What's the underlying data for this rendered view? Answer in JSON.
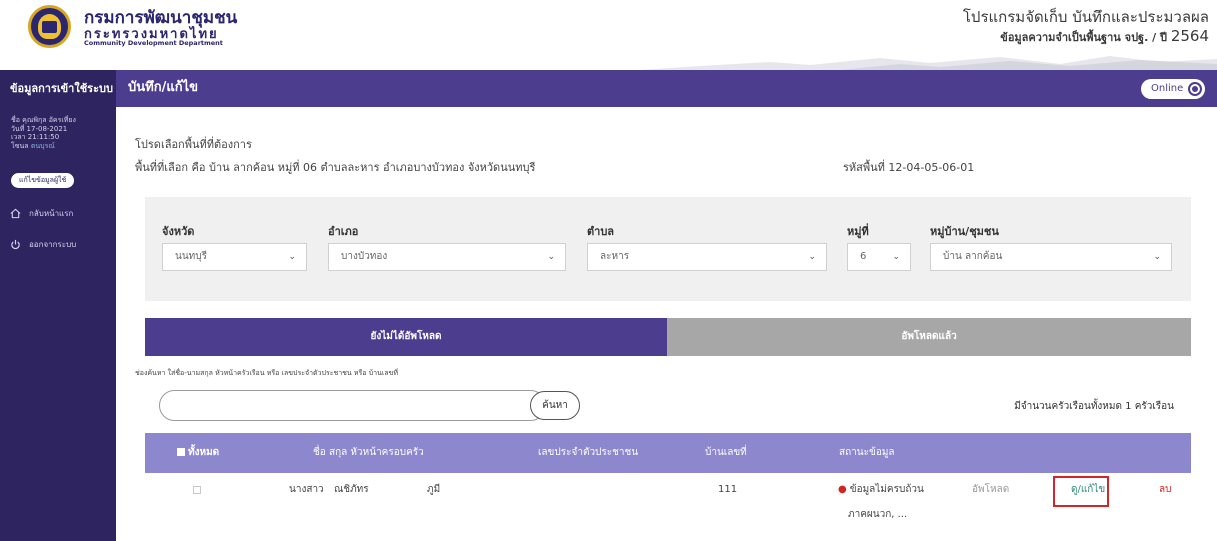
{
  "header": {
    "org_name": "กรมการพัฒนาชุมชน",
    "org_sub": "กระทรวงมหาดไทย",
    "org_en": "Community Development Department",
    "program_title": "โปรแกรมจัดเก็บ บันทึกและประมวลผล",
    "program_sub": "ข้อมูลความจำเป็นพื้นฐาน จปฐ. / ปี",
    "program_year": "2564"
  },
  "topbar": {
    "sidebar_heading": "ข้อมูลการเข้าใช้ระบบ",
    "page_title": "บันทึก/แก้ไข",
    "online_label": "Online"
  },
  "sidebar": {
    "name_line": "ชื่อ คุณพิกุล อัครเที่ยง",
    "date_line": "วันที่ 17-08-2021",
    "time_line": "เวลา 21:11:50",
    "zone_label": "โซนล",
    "zone_value": "ตนบุรณ์",
    "edit_profile": "แก้ไขข้อมูลผู้ใช้",
    "menu": [
      {
        "label": "กลับหน้าแรก",
        "icon": "home-icon"
      },
      {
        "label": "ออกจากระบบ",
        "icon": "power-icon"
      }
    ]
  },
  "main": {
    "hint": "โปรดเลือกพื้นที่ที่ต้องการ",
    "selected_area": "พื้นที่ที่เลือก คือ บ้าน ลากค้อน หมู่ที่ 06 ตำบลละหาร อำเภอบางบัวทอง จังหวัดนนทบุรี",
    "area_code": "รหัสพื้นที่ 12-04-05-06-01",
    "filters": {
      "province": {
        "label": "จังหวัด",
        "value": "นนทบุรี"
      },
      "district": {
        "label": "อำเภอ",
        "value": "บางบัวทอง"
      },
      "subdistrict": {
        "label": "ตำบล",
        "value": "ละหาร"
      },
      "moo": {
        "label": "หมู่ที่",
        "value": "6"
      },
      "village": {
        "label": "หมู่บ้าน/ชุมชน",
        "value": "บ้าน ลากค้อน"
      }
    },
    "tabs": {
      "not_uploaded": "ยังไม่ได้อัพโหลด",
      "uploaded": "อัพโหลดแล้ว"
    },
    "search_hint": "ช่องค้นหา ใส่ชื่อ-นามสกุล หัวหน้าครัวเรือน หรือ เลขประจำตัวประชาชน หรือ บ้านเลขที่",
    "search_placeholder": "",
    "search_button": "ค้นหา",
    "total_households": "มีจำนวนครัวเรือนทั้งหมด 1 ครัวเรือน",
    "table": {
      "columns": {
        "all": "ทั้งหมด",
        "head_name": "ชื่อ สกุล หัวหน้าครอบครัว",
        "citizen_id": "เลขประจำตัวประชาชน",
        "house_no": "บ้านเลขที่",
        "status": "สถานะข้อมูล"
      },
      "rows": [
        {
          "title": "นางสาว",
          "first_name": "ณชิภัทร",
          "last_name": "ภูมี",
          "citizen_id": "",
          "house_no": "111",
          "status_line1": "ข้อมูลไม่ครบถ้วน",
          "status_line2": "ภาคผนวก, ...",
          "upload": "อัพโหลด",
          "view_edit": "ดู/แก้ไข",
          "delete": "ลบ"
        }
      ]
    }
  },
  "colors": {
    "primary_purple": "#4c3d8f",
    "sidebar_dark": "#2d2460",
    "table_header": "#8d87cd",
    "highlight_red": "#d3262a",
    "tab_inactive": "#a7a7a7"
  }
}
